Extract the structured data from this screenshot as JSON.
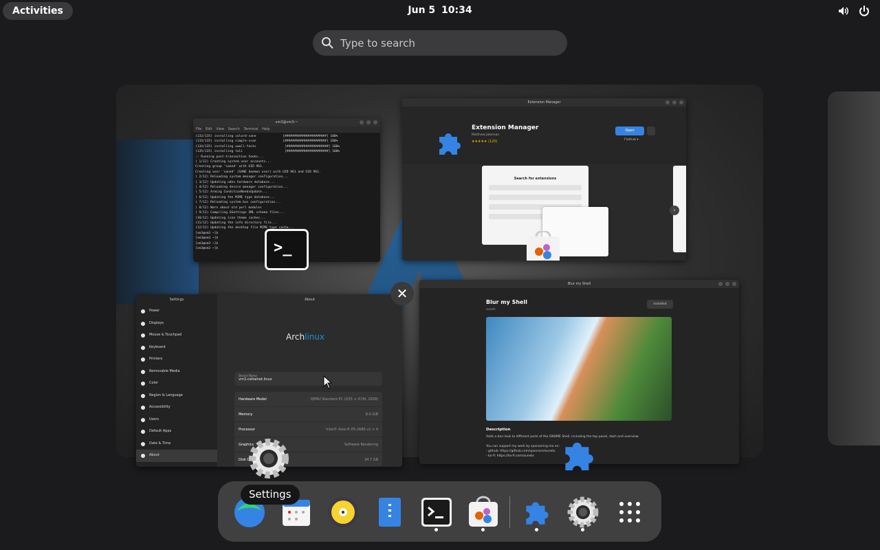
{
  "topbar": {
    "activities_label": "Activities",
    "date": "Jun 5",
    "time": "10:34",
    "volume_icon": "speaker-icon",
    "power_icon": "power-icon"
  },
  "search": {
    "placeholder": "Type to search"
  },
  "windows": {
    "terminal": {
      "title": "vm3@vm3:~",
      "menu": "File  Edit  View  Search  Terminal  Help",
      "lines": "(132/135) installing colord-sane              [######################] 100%\n(133/135) installing simple-scan              [######################] 100%\n(134/135) installing xwall-fonts               [######################] 100%\n(135/135) installing tali                      [######################] 100%\n:: Running post-transaction hooks...\n( 1/12) Creating system user accounts...\nCreating group 'saned' with GID 961.\nCreating user 'saned' (SANE daemon user) with UID 961 and GID 961.\n( 2/12) Reloading system manager configuration...\n( 3/12) Updating udev hardware database...\n( 4/12) Reloading device manager configuration...\n( 5/12) Arming ConditionNeedsUpdate...\n( 6/12) Updating the MIME type database...\n( 7/12) Reloading system bus configuration...\n( 8/12) Warn about old perl modules\n( 9/12) Compiling GSettings XML schema files...\n(10/12) Updating icon theme caches...\n(11/12) Updating the info directory file...\n(12/12) Updating the desktop file MIME type cache...\n[vm3@vm3 ~]$\n[vm3@vm3 ~]$\n[vm3@vm3 ~]$\n[vm3@vm3 ~]$ "
    },
    "extension_manager": {
      "title": "Extension Manager",
      "app_name": "Extension Manager",
      "author": "Matthew Jakeman",
      "rating": "★★★★★ (120)",
      "open_label": "Open",
      "source_label": "Flathub ▾",
      "shot_heading": "Search for extensions"
    },
    "settings": {
      "sidebar_title": "Settings",
      "page_title": "About",
      "sidebar_items": [
        "Power",
        "Displays",
        "Mouse & Touchpad",
        "Keyboard",
        "Printers",
        "Removable Media",
        "Color",
        "Region & Language",
        "Accessibility",
        "Users",
        "Default Apps",
        "Date & Time",
        "About"
      ],
      "logo_text_a": "Arch",
      "logo_text_b": "linux",
      "device_name_label": "Device Name",
      "device_name_value": "vm3.cottalnet.linux",
      "rows": [
        {
          "label": "Hardware Model",
          "value": "QEMU Standard PC (Q35 + ICH9, 2009)"
        },
        {
          "label": "Memory",
          "value": "8.0 GiB"
        },
        {
          "label": "Processor",
          "value": "Intel® Xeon® E5-2680 v2 × 4"
        },
        {
          "label": "Graphics",
          "value": "Software Rendering"
        },
        {
          "label": "Disk Capacity",
          "value": "34.7 GB"
        }
      ]
    },
    "blur_my_shell": {
      "title": "Blur my Shell",
      "app_name": "Blur my Shell",
      "author": "aunetx",
      "install_label": "Installed",
      "desc_heading": "Description",
      "desc": "Adds a blur look to different parts of the GNOME Shell, including the top panel, dash and overview.\n\nYou can support my work by sponsoring me on:\n - github: https://github.com/sponsors/aunetx\n - ko-fi: https://ko-fi.com/aunetx"
    }
  },
  "tooltip": "Settings",
  "dock": [
    {
      "name": "browser-icon",
      "running": false
    },
    {
      "name": "calendar-icon",
      "running": false
    },
    {
      "name": "rhythmbox-icon",
      "running": false
    },
    {
      "name": "files-icon",
      "running": false
    },
    {
      "name": "terminal-icon",
      "running": true
    },
    {
      "name": "software-icon",
      "running": true
    },
    {
      "name": "extension-manager-icon",
      "running": true
    },
    {
      "name": "settings-icon",
      "running": true
    },
    {
      "name": "show-apps-icon",
      "running": false
    }
  ],
  "colors": {
    "accent": "#3584e4",
    "panel": "#1b1b1d",
    "arch_blue": "#1793d1"
  }
}
